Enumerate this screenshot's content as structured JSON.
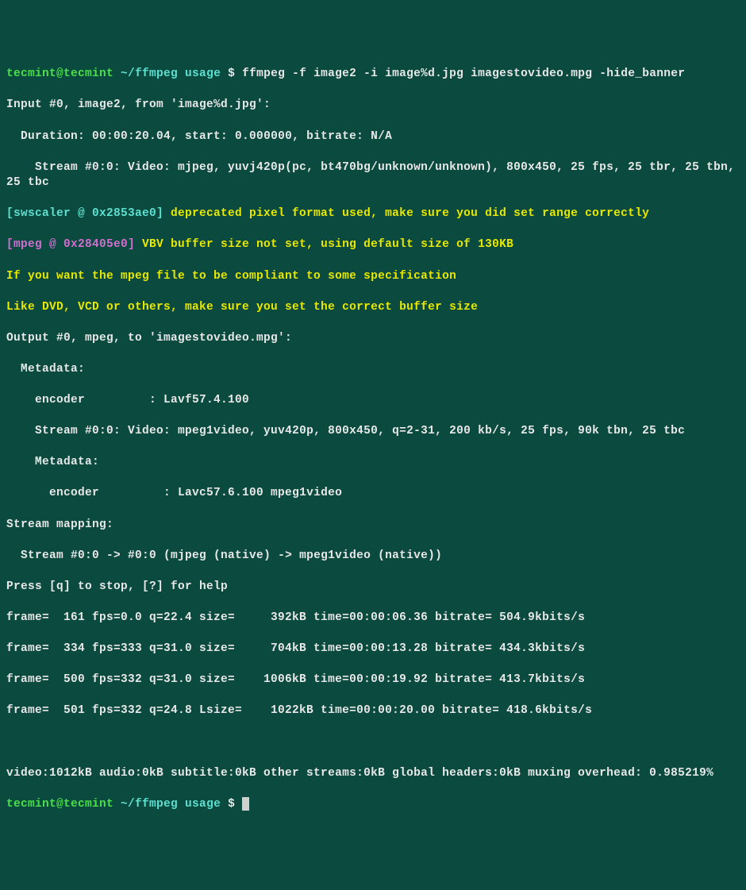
{
  "prompt": {
    "user_host": "tecmint@tecmint",
    "cwd": "~/ffmpeg usage",
    "dollar": "$",
    "command": "ffmpeg -f image2 -i image%d.jpg imagestovideo.mpg -hide_banner"
  },
  "out": {
    "input_header": "Input #0, image2, from 'image%d.jpg':",
    "duration": "  Duration: 00:00:20.04, start: 0.000000, bitrate: N/A",
    "stream_in": "    Stream #0:0: Video: mjpeg, yuvj420p(pc, bt470bg/unknown/unknown), 800x450, 25 fps, 25 tbr, 25 tbn, 25 tbc",
    "swscaler_tag": "[swscaler @ 0x2853ae0]",
    "swscaler_msg": " deprecated pixel format used, make sure you did set range correctly",
    "mpeg_tag": "[mpeg @ 0x28405e0]",
    "mpeg_msg": " VBV buffer size not set, using default size of 130KB",
    "compliant1": "If you want the mpeg file to be compliant to some specification",
    "compliant2": "Like DVD, VCD or others, make sure you set the correct buffer size",
    "output_header": "Output #0, mpeg, to 'imagestovideo.mpg':",
    "meta1": "  Metadata:",
    "encoder1": "    encoder         : Lavf57.4.100",
    "stream_out": "    Stream #0:0: Video: mpeg1video, yuv420p, 800x450, q=2-31, 200 kb/s, 25 fps, 90k tbn, 25 tbc",
    "meta2": "    Metadata:",
    "encoder2": "      encoder         : Lavc57.6.100 mpeg1video",
    "mapping_hdr": "Stream mapping:",
    "mapping": "  Stream #0:0 -> #0:0 (mjpeg (native) -> mpeg1video (native))",
    "press": "Press [q] to stop, [?] for help",
    "f1": "frame=  161 fps=0.0 q=22.4 size=     392kB time=00:00:06.36 bitrate= 504.9kbits/s",
    "f2": "frame=  334 fps=333 q=31.0 size=     704kB time=00:00:13.28 bitrate= 434.3kbits/s",
    "f3": "frame=  500 fps=332 q=31.0 size=    1006kB time=00:00:19.92 bitrate= 413.7kbits/s",
    "f4": "frame=  501 fps=332 q=24.8 Lsize=    1022kB time=00:00:20.00 bitrate= 418.6kbits/s",
    "summary": "video:1012kB audio:0kB subtitle:0kB other streams:0kB global headers:0kB muxing overhead: 0.985219%"
  },
  "prompt2": {
    "user_host": "tecmint@tecmint",
    "cwd": "~/ffmpeg usage",
    "dollar": "$"
  }
}
